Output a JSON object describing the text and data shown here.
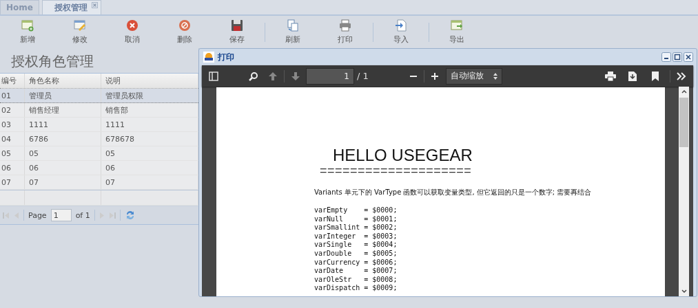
{
  "tabs": [
    {
      "label": "Home",
      "selected": false,
      "closable": false
    },
    {
      "label": "授权管理",
      "selected": true,
      "closable": true
    }
  ],
  "toolbar": [
    {
      "label": "新增",
      "kind": "add"
    },
    {
      "label": "修改",
      "kind": "edit"
    },
    {
      "label": "取消",
      "kind": "cancel"
    },
    {
      "label": "删除",
      "kind": "delete"
    },
    {
      "label": "保存",
      "kind": "save",
      "sep_after": true
    },
    {
      "label": "刷新",
      "kind": "refresh"
    },
    {
      "label": "打印",
      "kind": "print",
      "sep_after": true
    },
    {
      "label": "导入",
      "kind": "import",
      "sep_after": true
    },
    {
      "label": "导出",
      "kind": "export"
    }
  ],
  "panel_title": "授权角色管理",
  "table": {
    "columns": [
      "编号",
      "角色名称",
      "说明"
    ],
    "rows": [
      {
        "cells": [
          "01",
          "管理员",
          "管理员权限"
        ],
        "selected": true
      },
      {
        "cells": [
          "02",
          "销售经理",
          "销售部"
        ],
        "selected": false
      },
      {
        "cells": [
          "03",
          "1111",
          "1111"
        ],
        "selected": false
      },
      {
        "cells": [
          "04",
          "6786",
          "678678"
        ],
        "selected": false
      },
      {
        "cells": [
          "05",
          "05",
          "05"
        ],
        "selected": false
      },
      {
        "cells": [
          "06",
          "06",
          "06"
        ],
        "selected": false
      },
      {
        "cells": [
          "07",
          "07",
          "07"
        ],
        "selected": false
      }
    ]
  },
  "pager": {
    "page_label": "Page",
    "page": "1",
    "of_label": "of 1"
  },
  "dialog": {
    "title": "打印",
    "viewer": {
      "page_number": "1",
      "page_count": "/ 1",
      "zoom": "自动缩放",
      "document": {
        "heading": "HELLO USEGEAR",
        "rule": "====================",
        "paragraph": "Variants 单元下的 VarType 函数可以获取变量类型, 但它返回的只是一个数字; 需要再结合",
        "code": [
          "varEmpty    = $0000;",
          "varNull     = $0001;",
          "varSmallint = $0002;",
          "varInteger  = $0003;",
          "varSingle   = $0004;",
          "varDouble   = $0005;",
          "varCurrency = $0006;",
          "varDate     = $0007;",
          "varOleStr   = $0008;",
          "varDispatch = $0009;"
        ]
      }
    }
  }
}
